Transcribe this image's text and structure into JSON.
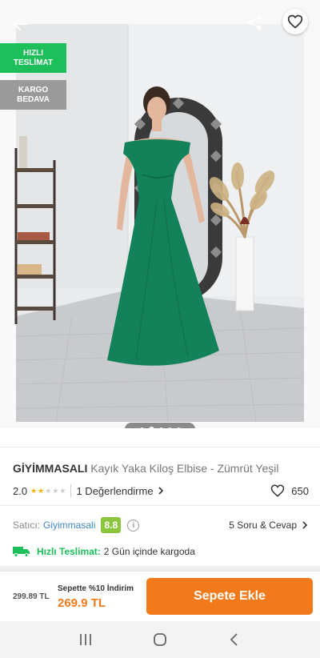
{
  "badges": {
    "fast_delivery": [
      "HIZLI",
      "TESLİMAT"
    ],
    "free_cargo": [
      "KARGO",
      "BEDAVA"
    ]
  },
  "gallery": {
    "image_count": 5,
    "active_index": 1
  },
  "product": {
    "brand": "GİYİMMASALI",
    "name": "Kayık Yaka Kiloş Elbise - Zümrüt Yeşil",
    "rating": "2.0",
    "rating_value": 2,
    "reviews": "1 Değerlendirme",
    "favorites": "650"
  },
  "seller": {
    "label": "Satıcı:",
    "name": "Giyimmasali",
    "score": "8.8",
    "qa": "5 Soru & Cevap"
  },
  "delivery": {
    "label": "Hızlı Teslimat:",
    "text": "2 Gün içinde kargoda"
  },
  "pricing": {
    "old_price": "299.89 TL",
    "promo": "Sepette %10 İndirim",
    "new_price": "269.9 TL",
    "add_to_cart": "Sepete Ekle"
  },
  "colors": {
    "brand_orange": "#f27a1a",
    "fast_green": "#1dbf5a",
    "seller_blue": "#3f87c9",
    "score_green": "#8cc63e",
    "star_yellow": "#f5b301",
    "dress_green": "#13825a"
  }
}
